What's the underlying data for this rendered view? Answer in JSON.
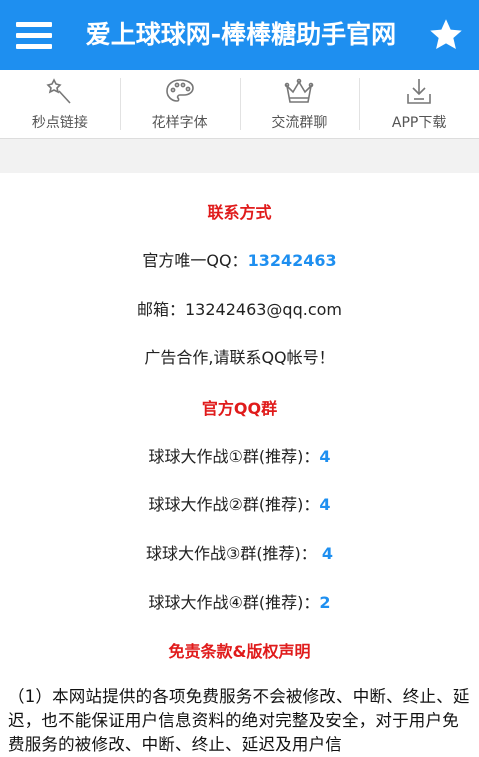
{
  "header": {
    "title": "爱上球球网-棒棒糖助手官网",
    "menu_icon": "hamburger-menu-icon",
    "favorite_icon": "star-icon",
    "color": "#1e8ff0"
  },
  "toolbar": {
    "items": [
      {
        "label": "秒点链接",
        "icon": "magic-wand-icon"
      },
      {
        "label": "花样字体",
        "icon": "palette-icon"
      },
      {
        "label": "交流群聊",
        "icon": "crown-icon"
      },
      {
        "label": "APP下载",
        "icon": "download-icon"
      }
    ]
  },
  "contact": {
    "heading": "联系方式",
    "qq_label": "官方唯一QQ：",
    "qq_value": "13242463",
    "email": "邮箱：13242463@qq.com",
    "ad": "广告合作,请联系QQ帐号！"
  },
  "groups": {
    "heading": "官方QQ群",
    "items": [
      {
        "label": "球球大作战①群(推荐)：",
        "value": "4"
      },
      {
        "label": "球球大作战②群(推荐)：",
        "value": "4"
      },
      {
        "label": "球球大作战③群(推荐)： ",
        "value": "4"
      },
      {
        "label": "球球大作战④群(推荐)：",
        "value": "2"
      }
    ]
  },
  "disclaimer": {
    "heading": "免责条款&版权声明",
    "paragraph": "（1）本网站提供的各项免费服务不会被修改、中断、终止、延迟，也不能保证用户信息资料的绝对完整及安全，对于用户免费服务的被修改、中断、终止、延迟及用户信"
  },
  "colors": {
    "accent": "#1e8ff0",
    "heading_red": "#e01b1b"
  }
}
